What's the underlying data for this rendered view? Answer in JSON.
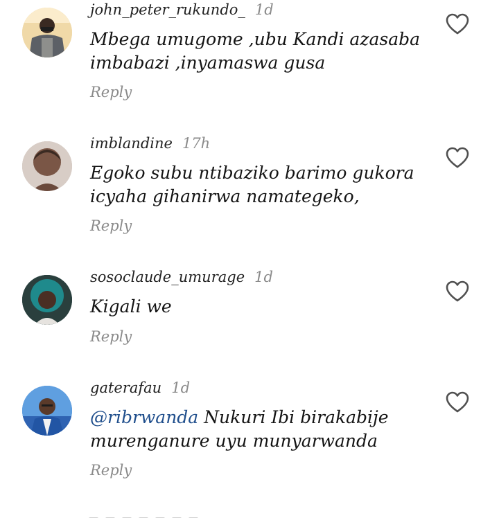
{
  "comments": [
    {
      "username": "john_peter_rukundo_",
      "time": "1d",
      "mention": "",
      "lines": [
        "Mbega umugome ,ubu Kandi azasaba",
        "imbabazi ,inyamaswa gusa"
      ],
      "reply": "Reply",
      "like_icon": "heart-outline-icon"
    },
    {
      "username": "imblandine",
      "time": "17h",
      "mention": "",
      "lines": [
        "Egoko subu ntibaziko barimo gukora",
        "icyaha gihanirwa namategeko,"
      ],
      "reply": "Reply",
      "like_icon": "heart-outline-icon"
    },
    {
      "username": "sosoclaude_umurage",
      "time": "1d",
      "mention": "",
      "lines": [
        "Kigali we"
      ],
      "reply": "Reply",
      "like_icon": "heart-outline-icon"
    },
    {
      "username": "gaterafau",
      "time": "1d",
      "mention": "@ribrwanda",
      "lines": [
        "Nukuri Ibi birakabije",
        "murenganure uyu munyarwanda"
      ],
      "reply": "Reply",
      "like_icon": "heart-outline-icon"
    }
  ],
  "colors": {
    "mention": "#1f4e8c",
    "muted_text": "#8a8a8a",
    "primary_text": "#141414",
    "background": "#ffffff"
  }
}
